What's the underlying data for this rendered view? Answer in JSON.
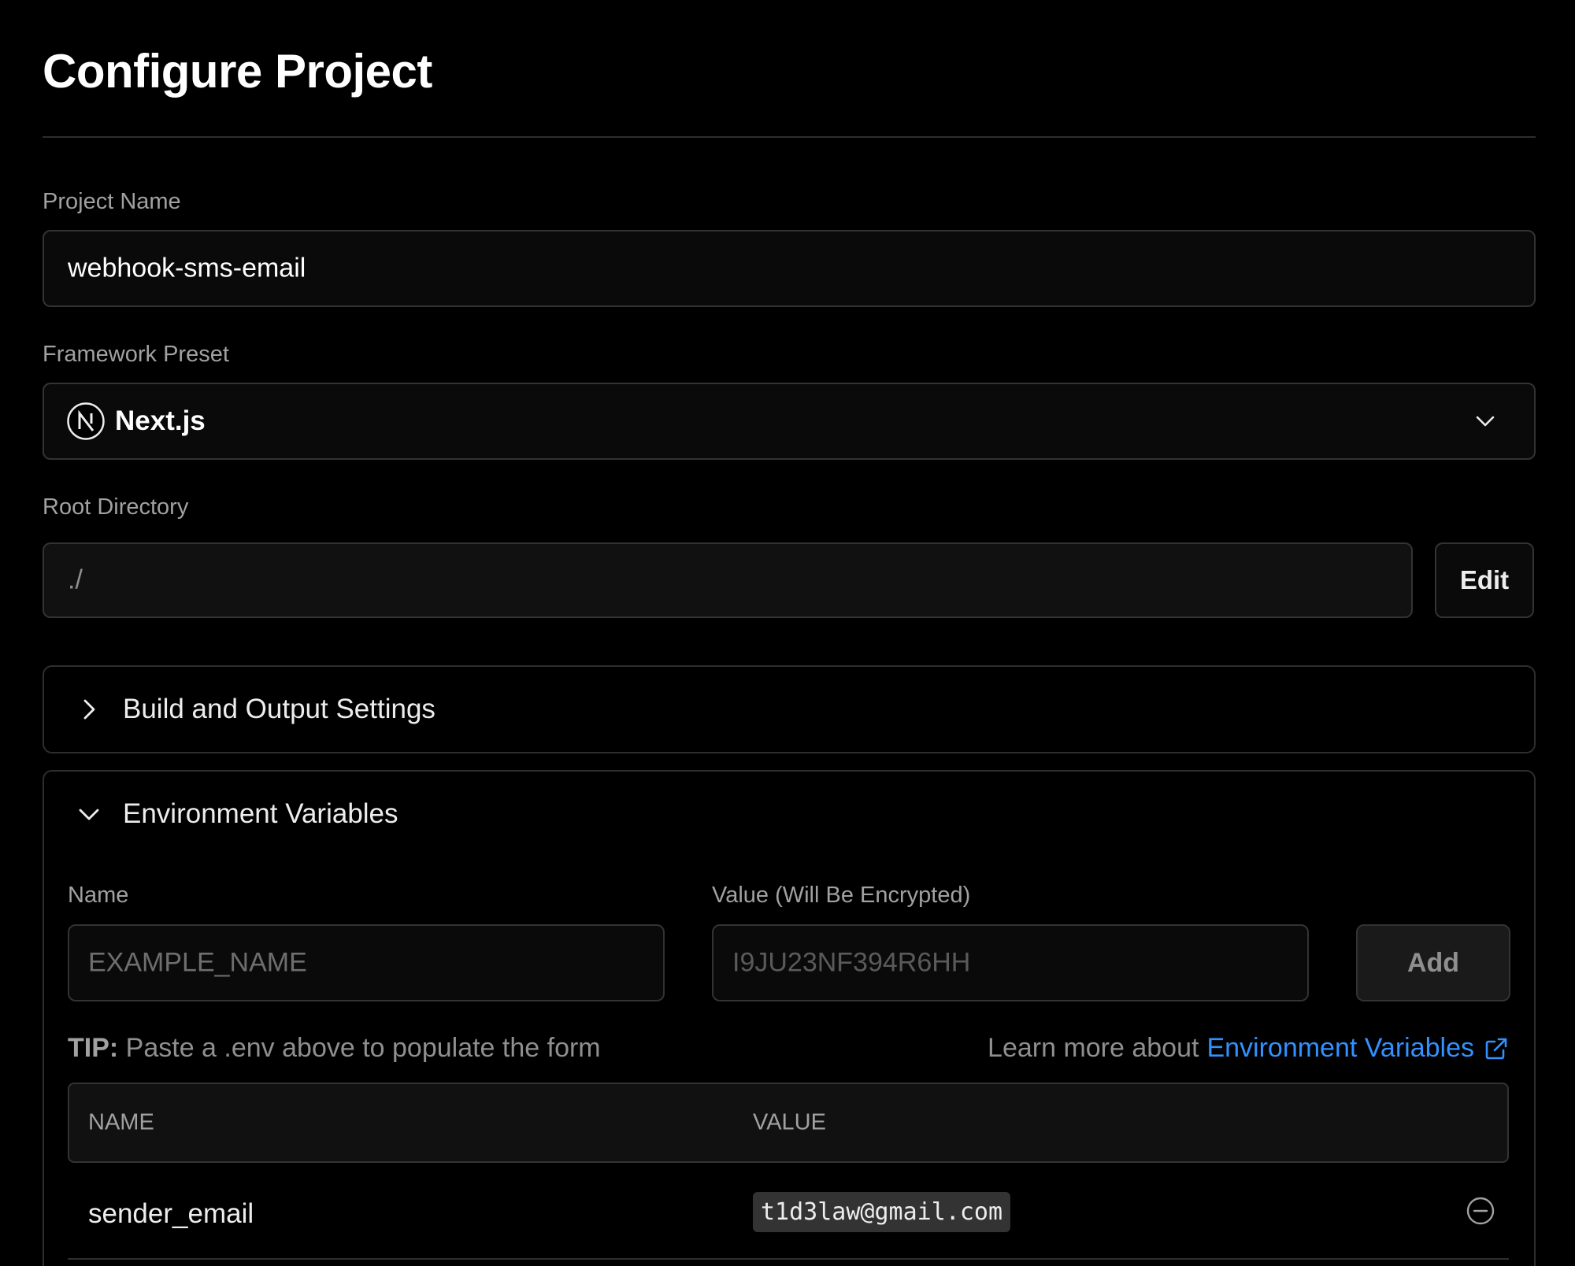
{
  "page": {
    "title": "Configure Project"
  },
  "project_name": {
    "label": "Project Name",
    "value": "webhook-sms-email"
  },
  "framework_preset": {
    "label": "Framework Preset",
    "selected": "Next.js",
    "icon": "nextjs-logo"
  },
  "root_directory": {
    "label": "Root Directory",
    "value": "./",
    "edit_label": "Edit"
  },
  "build_settings": {
    "label": "Build and Output Settings",
    "expanded": false
  },
  "env_vars": {
    "label": "Environment Variables",
    "expanded": true,
    "name_label": "Name",
    "value_label": "Value (Will Be Encrypted)",
    "name_placeholder": "EXAMPLE_NAME",
    "value_placeholder": "I9JU23NF394R6HH",
    "add_label": "Add",
    "tip_prefix": "TIP:",
    "tip_text": " Paste a .env above to populate the form",
    "learn_prefix": "Learn more about",
    "learn_link": "Environment Variables",
    "table": {
      "headers": [
        "NAME",
        "VALUE"
      ],
      "rows": [
        {
          "name": "sender_email",
          "value": "t1d3law@gmail.com"
        }
      ]
    }
  },
  "colors": {
    "background": "#000000",
    "border": "#333333",
    "link": "#3291ff",
    "muted_text": "#a1a1a1"
  }
}
